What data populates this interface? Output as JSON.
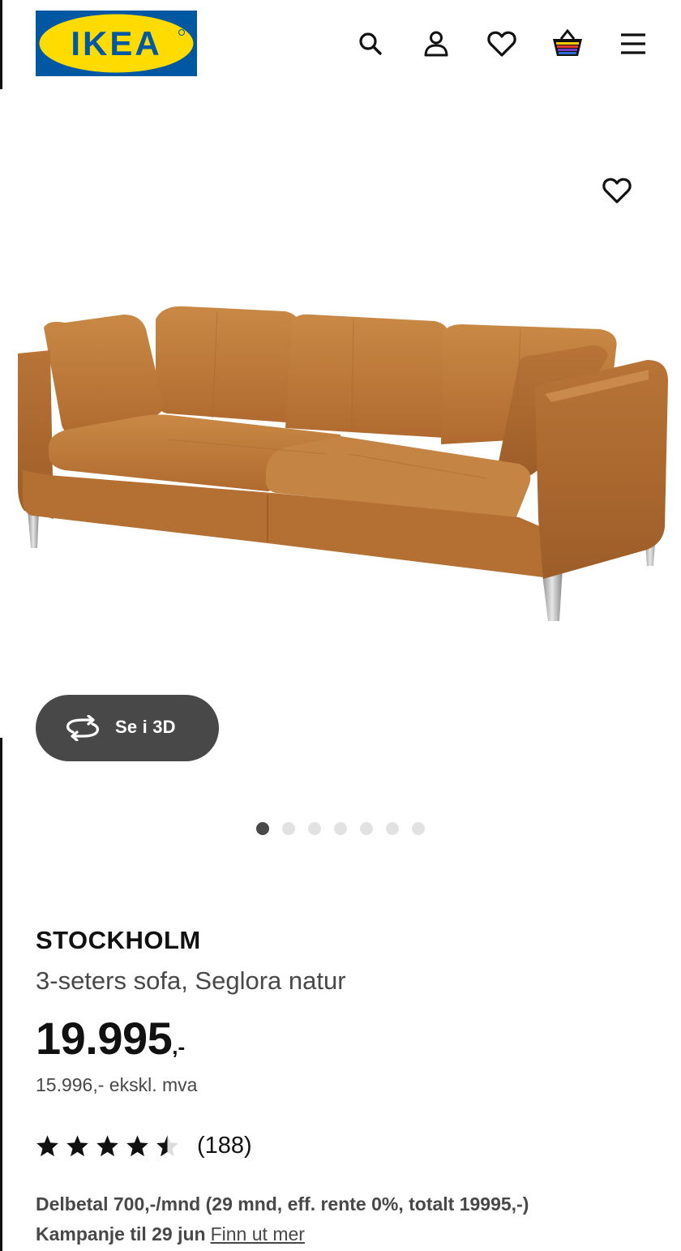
{
  "header": {
    "logo_text": "IKEA",
    "icons": [
      "search-icon",
      "user-icon",
      "heart-icon",
      "basket-icon",
      "menu-icon"
    ]
  },
  "gallery": {
    "view_3d_label": "Se i 3D",
    "slide_count": 7,
    "active_slide": 1
  },
  "product": {
    "name": "STOCKHOLM",
    "description": "3-seters sofa, Seglora natur",
    "price": "19.995",
    "price_suffix": ",-",
    "price_ex_vat": "15.996,- ekskl. mva",
    "rating": 4.5,
    "rating_max": 5,
    "review_count": "(188)",
    "financing_line": "Delbetal 700,-/mnd (29 mnd, eff. rente 0%, totalt 19995,-)",
    "campaign_text": "Kampanje til 29 jun",
    "campaign_link": "Finn ut mer"
  },
  "colors": {
    "ikea_blue": "#0058a3",
    "ikea_yellow": "#ffdb00",
    "dark_gray": "#484848",
    "leather": "#c07a3e"
  }
}
